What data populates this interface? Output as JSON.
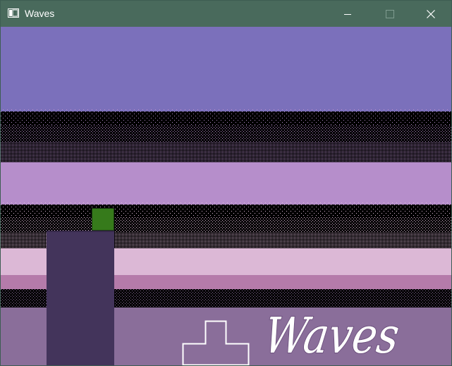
{
  "window": {
    "title": "Waves",
    "titlebar_color": "#496a5c"
  },
  "controls": {
    "minimize_icon": "minimize-icon",
    "maximize_icon": "maximize-icon",
    "close_icon": "close-icon"
  },
  "game": {
    "logo_text": "Waves",
    "colors": {
      "sky_top": "#7b70bb",
      "sky_mid": "#b68ecb",
      "sky_low": "#dcb8d6",
      "horizon_band": "#b57baa",
      "water": "#8a6e9a",
      "pillar": "#43345b",
      "player": "#367a1b",
      "player_outline": "#1a3a10",
      "outline_block": "#ffffff"
    },
    "player_icon": "green-block",
    "block_icon": "t-shaped-outline-block"
  }
}
